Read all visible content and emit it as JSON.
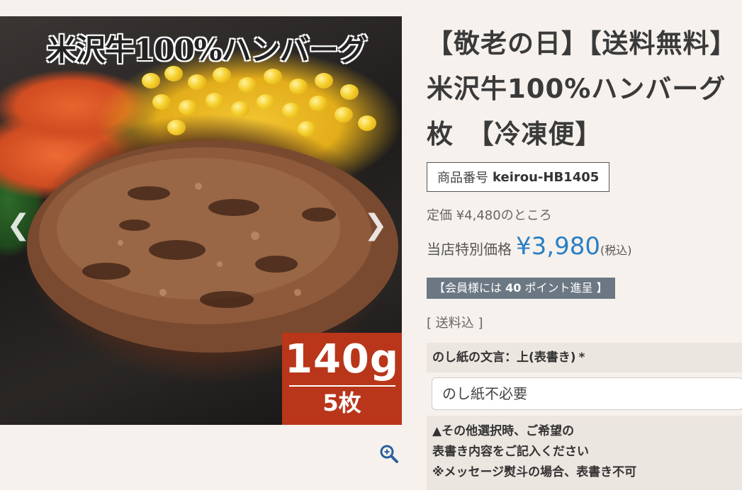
{
  "image": {
    "overlay_title": "米沢牛100%ハンバーグ",
    "badge_weight": "140g",
    "badge_count": "5枚",
    "prev_icon": "chevron-left-icon",
    "next_icon": "chevron-right-icon",
    "zoom_icon": "zoom-in-icon"
  },
  "product": {
    "title_lines": [
      "【敬老の日】【送料無料】",
      "米沢牛100%ハンバーグ",
      "枚　【冷凍便】"
    ],
    "sku_label": "商品番号",
    "sku_value": "keirou-HB1405",
    "list_price_text": "定価 ¥4,480のところ",
    "special_label": "当店特別価格",
    "special_price": "¥3,980",
    "tax_note": "(税込)",
    "points_prefix": "【会員様には",
    "points_value": "40",
    "points_suffix": "ポイント進呈 】",
    "shipping_text": "[ 送料込 ]"
  },
  "noshi": {
    "label": "のし紙の文言：上(表書き)",
    "required_mark": "*",
    "selected_option": "のし紙不必要",
    "note_lines": [
      "▲その他選択時、ご希望の",
      "表書き内容をご記入ください",
      "※メッセージ熨斗の場合、表書き不可"
    ]
  },
  "colors": {
    "background": "#f6f1ec",
    "price_accent": "#2a7fc4",
    "badge_red": "#b9361a",
    "points_bg": "#6b7883"
  }
}
